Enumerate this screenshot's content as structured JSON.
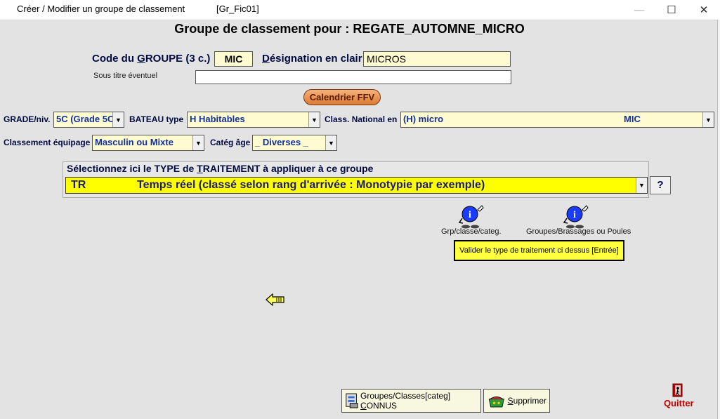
{
  "window": {
    "title": "Créer / Modifier un groupe de classement",
    "form_code": "[Gr_Fic01]",
    "minimize_glyph": "—",
    "maximize_glyph": "☐",
    "close_glyph": "✕"
  },
  "heading": "Groupe de classement pour : REGATE_AUTOMNE_MICRO",
  "code_groupe": {
    "label_pre": "Code du ",
    "label_accel": "G",
    "label_post": "ROUPE (3 c.)",
    "value": "MIC"
  },
  "designation": {
    "label_accel": "D",
    "label_post": "ésignation en clair",
    "value": "MICROS"
  },
  "sous_titre": {
    "label": "Sous titre éventuel",
    "value": ""
  },
  "calendrier_button": "Calendrier FFV",
  "grade": {
    "label": "GRADE/niv.",
    "value": "5C (Grade 5C"
  },
  "bateau": {
    "label": "BATEAU type",
    "value": "H  Habitables"
  },
  "class_national": {
    "label": "Class. National en",
    "value": "(H)  micro",
    "code": "MIC"
  },
  "classement_equipage": {
    "label": "Classement équipage",
    "value": "Masculin ou Mixte"
  },
  "categ_age": {
    "label": "Catég âge",
    "value": "_ Diverses _"
  },
  "traitement": {
    "title_pre": "Sélectionnez ici le TYPE de ",
    "title_accel": "T",
    "title_post": "RAITEMENT à appliquer à ce groupe",
    "code": "TR",
    "value": "Temps réel (classé selon rang d'arrivée : Monotypie par exemple)",
    "help_label": "?"
  },
  "info_links": [
    {
      "label": "Grp/classe/categ.",
      "icon": "info-person-icon"
    },
    {
      "label": "Groupes/Brassages ou Poules",
      "icon": "info-person-icon"
    }
  ],
  "valider_button": "Valider le type de traitement ci dessus  [Entrée]",
  "bottom": {
    "connus_pre": "Groupes/Classes[categ] ",
    "connus_accel": "C",
    "connus_post": "ONNUS",
    "supprimer_accel": "S",
    "supprimer_post": "upprimer",
    "quitter": "Quitter"
  },
  "colors": {
    "field_bg": "#fffbd0",
    "traitement_bg": "#ffff00",
    "window_bg": "#e3e3e3",
    "quit_red": "#c00000"
  }
}
